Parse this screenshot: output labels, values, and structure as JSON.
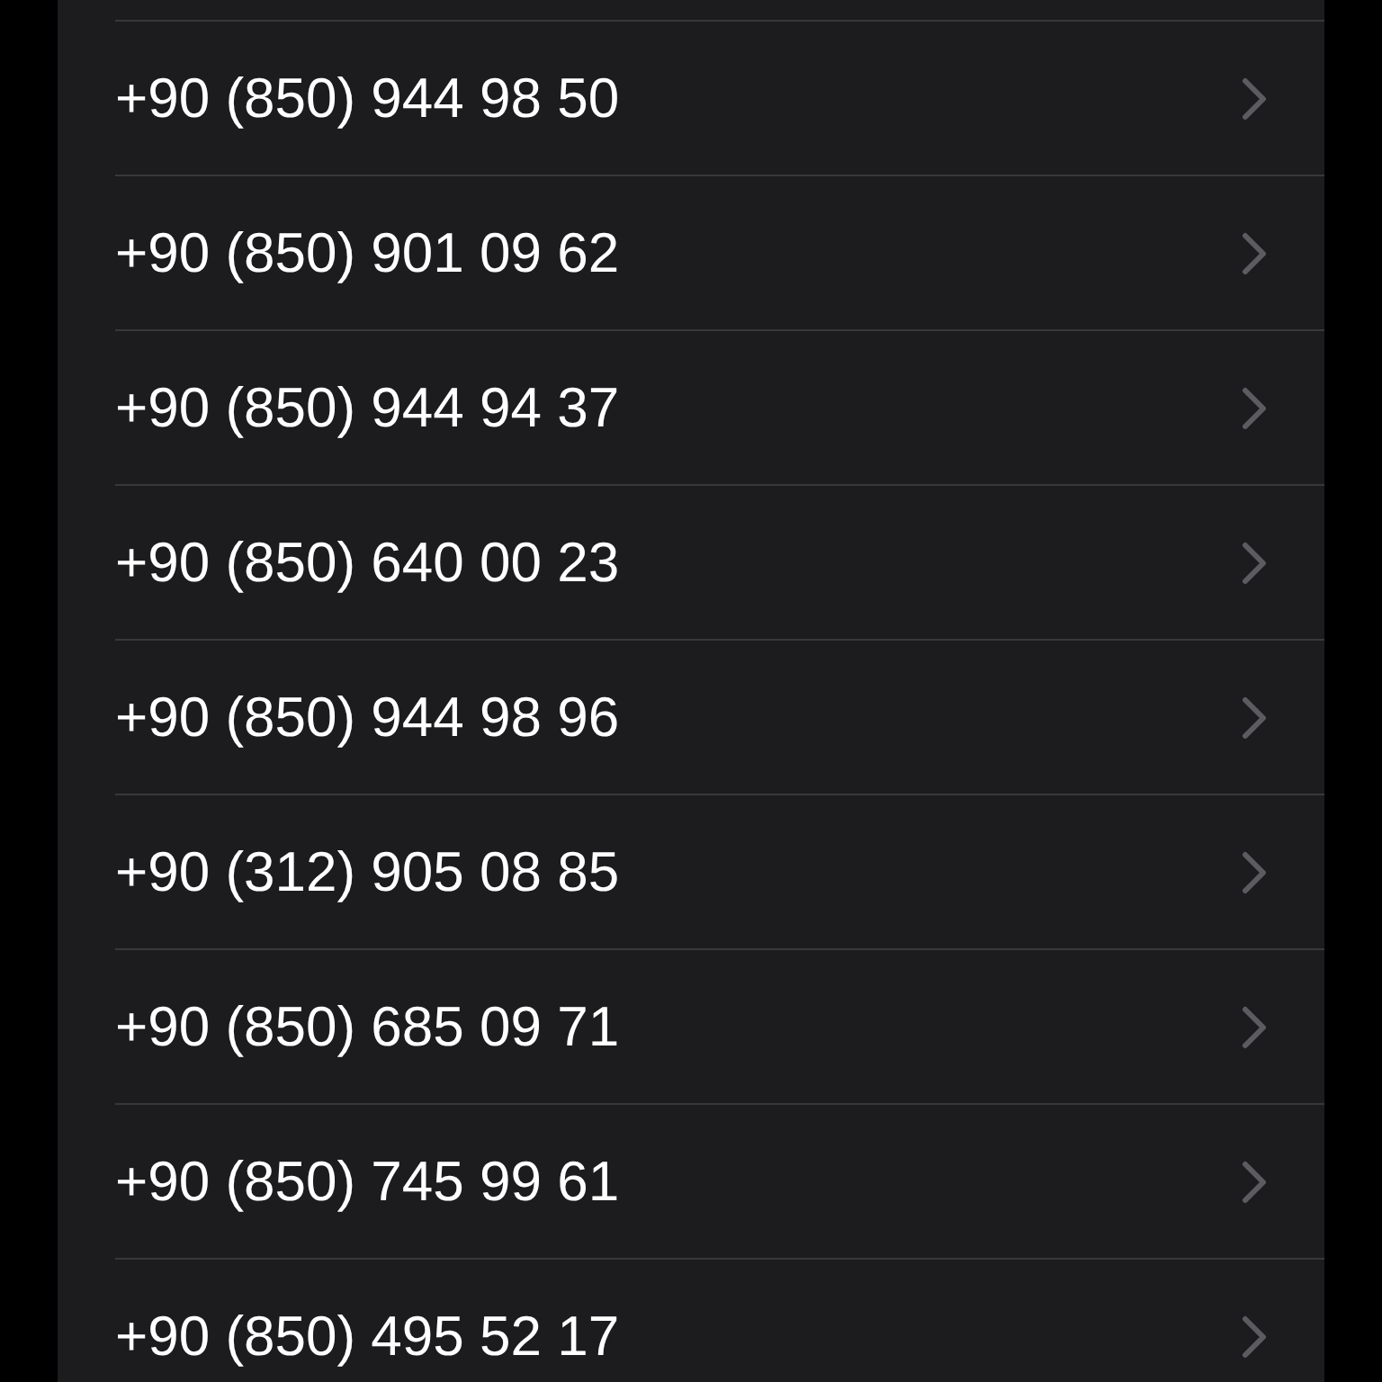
{
  "phone_numbers": [
    {
      "number": "+90 (850) 944 98 50"
    },
    {
      "number": "+90 (850) 901 09 62"
    },
    {
      "number": "+90 (850) 944 94 37"
    },
    {
      "number": "+90 (850) 640 00 23"
    },
    {
      "number": "+90 (850) 944 98 96"
    },
    {
      "number": "+90 (312) 905 08 85"
    },
    {
      "number": "+90 (850) 685 09 71"
    },
    {
      "number": "+90 (850) 745 99 61"
    },
    {
      "number": "+90 (850) 495 52 17"
    }
  ]
}
